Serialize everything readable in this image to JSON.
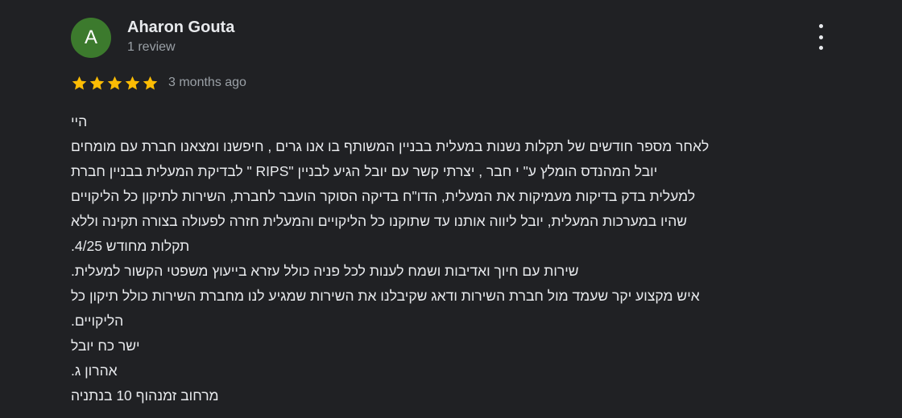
{
  "review": {
    "avatar_letter": "A",
    "author": "Aharon Gouta",
    "review_count": "1 review",
    "rating": 5,
    "rating_max": 5,
    "date": "3 months ago",
    "lines": [
      "היי",
      "לאחר מספר חודשים של תקלות נשנות במעלית בבניין המשותף בו אנו גרים , חיפשנו ומצאנו חברת עם מומחים",
      "יובל המהנדס הומלץ ע\" י חבר , יצרתי קשר עם יובל הגיע לבניין \"RIPS \" לבדיקת המעלית בבניין חברת",
      "למעלית בדק בדיקות מעמיקות את המעלית, הדו\"ח בדיקה הסוקר הועבר לחברת, השירות לתיקון כל הליקויים",
      "שהיו במערכות המעלית, יובל ליווה אותנו עד שתוקנו כל הליקויים והמעלית חזרה לפעולה בצורה תקינה וללא",
      "תקלות מחודש 4/25.",
      "שירות עם חיוך ואדיבות ושמח לענות לכל פניה כולל עזרא בייעוץ משפטי הקשור למעלית.",
      "איש מקצוע יקר שעמד מול חברת השירות ודאג שקיבלנו את השירות שמגיע לנו מחברת השירות כולל תיקון כל",
      "הליקויים.",
      "ישר כח יובל",
      "אהרון ג.",
      "מרחוב זמנהוף 10 בנתניה"
    ]
  },
  "colors": {
    "background": "#202124",
    "avatar": "#3c7a2d",
    "star": "#fbbc04",
    "text": "#e8eaed",
    "muted": "#9aa0a6"
  },
  "icons": {
    "star": "star-icon",
    "more": "more-vert-icon"
  }
}
